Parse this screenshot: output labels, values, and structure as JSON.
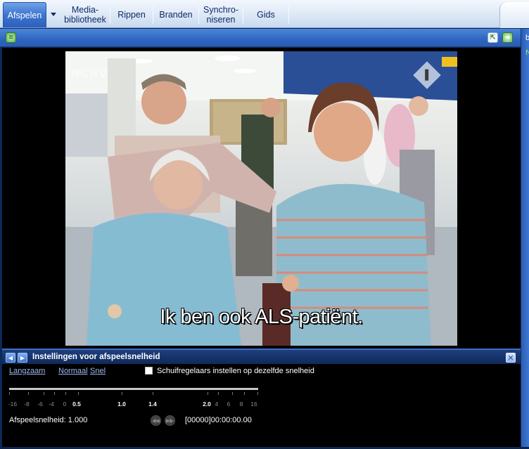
{
  "tabs": [
    {
      "label": "Afspelen",
      "active": true
    },
    {
      "label": "Media-\nbibliotheek",
      "active": false
    },
    {
      "label": "Rippen",
      "active": false
    },
    {
      "label": "Branden",
      "active": false
    },
    {
      "label": "Synchro-\nniseren",
      "active": false
    },
    {
      "label": "Gids",
      "active": false
    }
  ],
  "toolbar": {
    "menu_icon": "green-menu-icon",
    "pip_icon": "compact-mode-icon",
    "next_icon": "green-arrow-icon"
  },
  "rightstrip": {
    "text1": "b",
    "text2": "N"
  },
  "video": {
    "channel_logo": "NCRV",
    "subtitle": "Ik ben ook ALS-patiënt."
  },
  "panel": {
    "title": "Instellingen voor afspeelsnelheid",
    "prev_icon": "left-arrow-icon",
    "next_icon": "right-arrow-icon",
    "close_icon": "close-icon",
    "links": {
      "slow": "Langzaam",
      "normal": "Normaal",
      "fast": "Snel"
    },
    "checkbox_label": "Schuifregelaars instellen op dezelfde snelheid",
    "checkbox_checked": false,
    "slider_labels": [
      "-16",
      "-8",
      "-6",
      "-4",
      "0",
      "0.5",
      "1.0",
      "1.4",
      "2.0",
      "4",
      "6",
      "8",
      "16"
    ],
    "slider_value": 1.0,
    "rate_text": "Afspeelsnelheid: 1.000",
    "timecode": "[00000]00:00:00.00"
  },
  "colors": {
    "accent": "#2f66c1",
    "tab_active": "#3d74cf",
    "panel_bg": "#000000",
    "link": "#9db9ee"
  }
}
